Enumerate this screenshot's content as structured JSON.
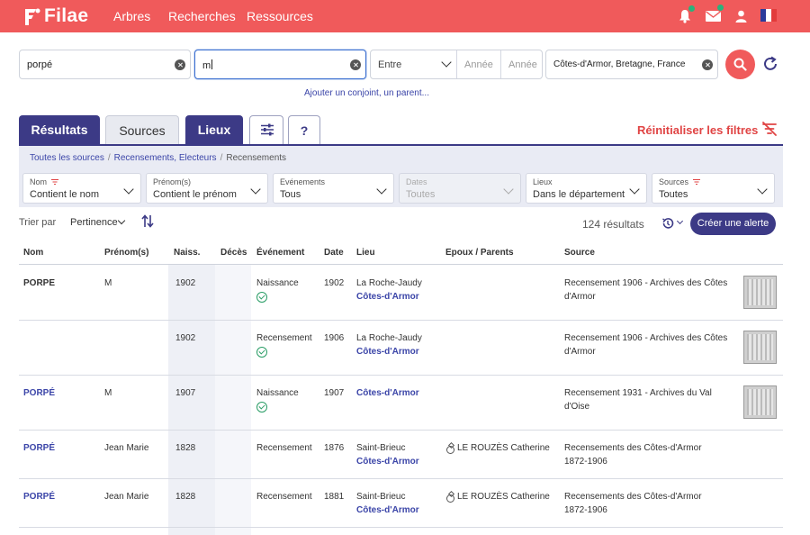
{
  "brand": {
    "name": "Filae"
  },
  "nav": {
    "items": [
      "Arbres",
      "Recherches",
      "Ressources"
    ]
  },
  "search": {
    "last_name": "porpé",
    "first_name": "m",
    "event_range": "Entre",
    "year_from_placeholder": "Année",
    "year_to_placeholder": "Année",
    "place": "Côtes-d'Armor, Bretagne, France",
    "add_relative_link": "Ajouter un conjoint, un parent..."
  },
  "tabs": {
    "results": "Résultats",
    "sources": "Sources",
    "places": "Lieux",
    "help": "?"
  },
  "reset_filters": "Réinitialiser les filtres",
  "breadcrumb": [
    "Toutes les sources",
    "Recensements, Electeurs",
    "Recensements"
  ],
  "filters": [
    {
      "label": "Nom",
      "value": "Contient le nom",
      "disabled": false
    },
    {
      "label": "Prénom(s)",
      "value": "Contient le prénom",
      "disabled": false
    },
    {
      "label": "Evénements",
      "value": "Tous",
      "disabled": false
    },
    {
      "label": "Dates",
      "value": "Toutes",
      "disabled": true
    },
    {
      "label": "Lieux",
      "value": "Dans le département",
      "disabled": false
    },
    {
      "label": "Sources",
      "value": "Toutes",
      "disabled": false
    }
  ],
  "sort": {
    "label": "Trier par",
    "value": "Pertinence"
  },
  "results_count": "124 résultats",
  "create_alert": "Créer une alerte",
  "table": {
    "headers": [
      "Nom",
      "Prénom(s)",
      "Naiss.",
      "Décès",
      "Événement",
      "Date",
      "Lieu",
      "Epoux / Parents",
      "Source"
    ],
    "rows": [
      {
        "nom": "PORPE",
        "prenom": "M",
        "naiss": "1902",
        "event": "Naissance",
        "date": "1902",
        "place": "La Roche-Jaudy",
        "place_sub": "Côtes-d'Armor",
        "spouse": "",
        "source1": "Recensement 1906 - Archives des Côtes",
        "source2": "d'Armor"
      },
      {
        "nom": "",
        "prenom": "",
        "naiss": "1902",
        "event": "Recensement",
        "date": "1906",
        "place": "La Roche-Jaudy",
        "place_sub": "Côtes-d'Armor",
        "spouse": "",
        "source1": "Recensement 1906 - Archives des Côtes",
        "source2": "d'Armor"
      },
      {
        "nom": "PORPÉ",
        "prenom": "M",
        "naiss": "1907",
        "event": "Naissance",
        "date": "1907",
        "place": "",
        "place_sub": "Côtes-d'Armor",
        "spouse": "",
        "source1": "Recensement 1931 - Archives du Val",
        "source2": "d'Oise"
      },
      {
        "nom": "PORPÉ",
        "prenom": "Jean Marie",
        "naiss": "1828",
        "event": "Recensement",
        "date": "1876",
        "place": "Saint-Brieuc",
        "place_sub": "Côtes-d'Armor",
        "spouse": "LE ROUZÈS Catherine",
        "source1": "Recensements des Côtes-d'Armor",
        "source2": "1872-1906"
      },
      {
        "nom": "PORPÉ",
        "prenom": "Jean Marie",
        "naiss": "1828",
        "event": "Recensement",
        "date": "1881",
        "place": "Saint-Brieuc",
        "place_sub": "Côtes-d'Armor",
        "spouse": "LE ROUZÈS Catherine",
        "source1": "Recensements des Côtes-d'Armor",
        "source2": "1872-1906"
      }
    ]
  },
  "colors": {
    "brand_red": "#f05a5b",
    "accent_navy": "#3c3a86",
    "link_blue": "#3b45a8",
    "check_green": "#2a9d66"
  }
}
